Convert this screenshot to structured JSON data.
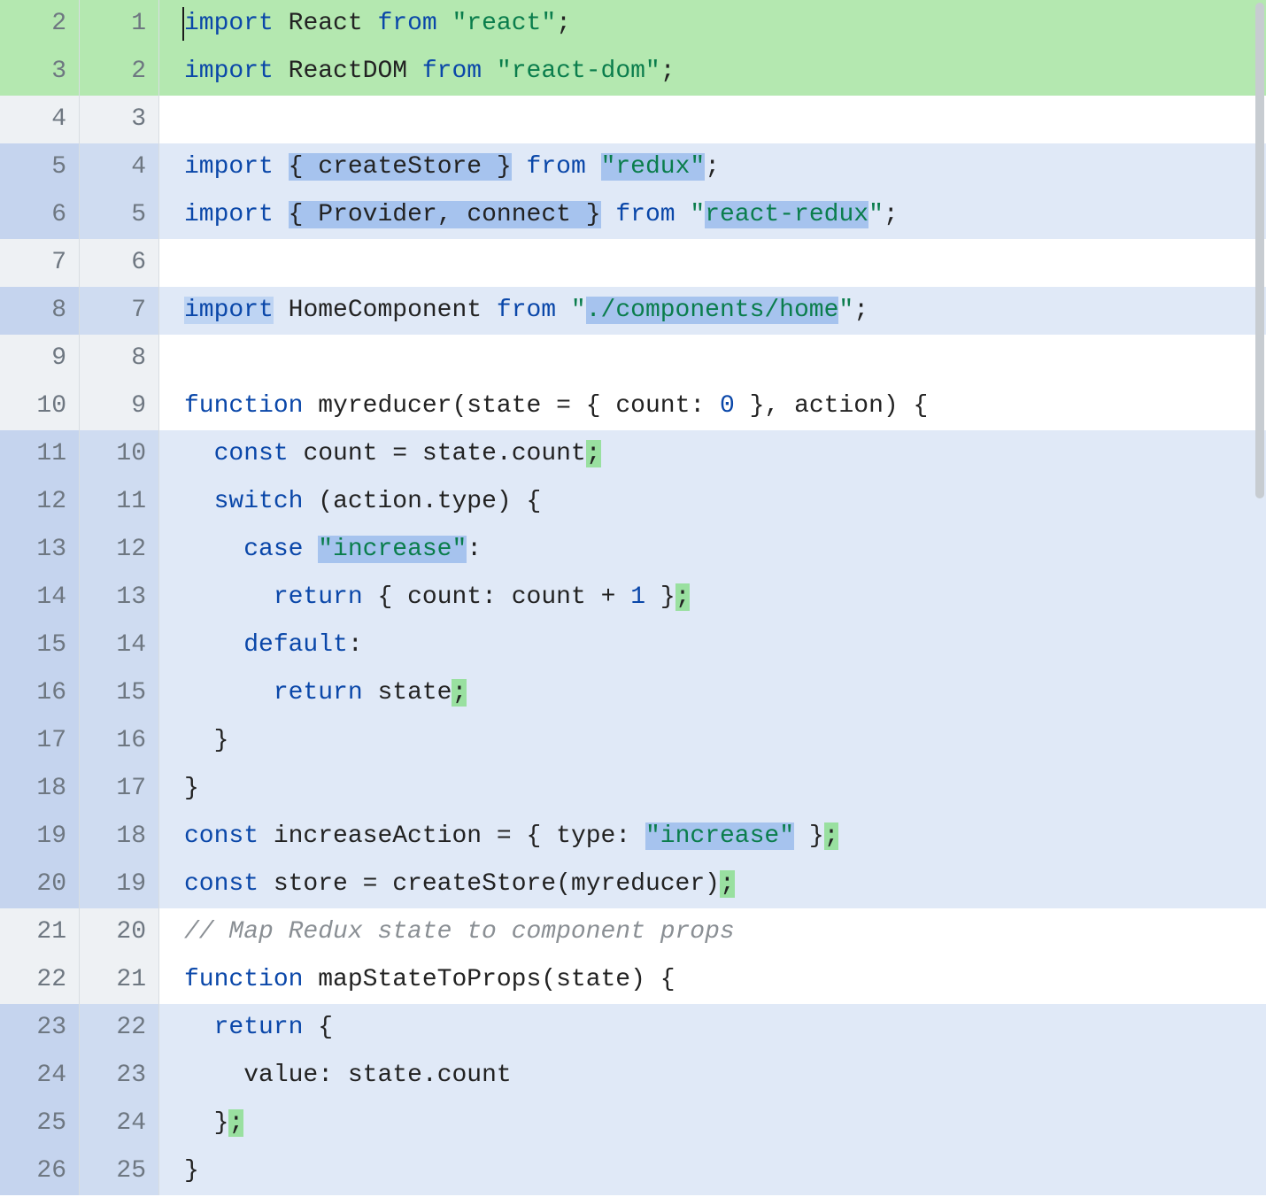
{
  "colors": {
    "add_bg": "#b4e8b0",
    "mod_bg": "#e0e9f7",
    "gutter_bg": "#eef1f4",
    "hl_blue": "#a6c3ee",
    "hl_green": "#99e0a0"
  },
  "rows": [
    {
      "l": "2",
      "r": "1",
      "state": "add",
      "code_html": "<span class='kw'>import</span> <span class='id'>React</span> <span class='kw'>from</span> <span class='str'>\"react\"</span><span class='punc'>;</span>",
      "cursor": true
    },
    {
      "l": "3",
      "r": "2",
      "state": "add",
      "code_html": "<span class='kw'>import</span> <span class='id'>ReactDOM</span> <span class='kw'>from</span> <span class='str'>\"react-dom\"</span><span class='punc'>;</span>"
    },
    {
      "l": "4",
      "r": "3",
      "state": "context",
      "code_html": ""
    },
    {
      "l": "5",
      "r": "4",
      "state": "mod",
      "code_html": "<span class='kw'>import</span> <span class='hl-blue'><span class='punc'>{</span> <span class='id'>createStore</span> <span class='punc'>}</span></span> <span class='kw'>from</span> <span class='str hl-blue'>\"redux\"</span><span class='punc'>;</span>"
    },
    {
      "l": "6",
      "r": "5",
      "state": "mod",
      "code_html": "<span class='kw'>import</span> <span class='hl-blue'><span class='punc'>{</span> <span class='id'>Provider</span><span class='punc'>,</span> <span class='id'>connect</span> <span class='punc'>}</span></span> <span class='kw'>from</span> <span class='str'>\"<span class='hl-blue'>react-redux</span>\"</span><span class='punc'>;</span>"
    },
    {
      "l": "7",
      "r": "6",
      "state": "context",
      "code_html": ""
    },
    {
      "l": "8",
      "r": "7",
      "state": "mod",
      "code_html": "<span class='hl-blue2'><span class='kw'>import</span></span> <span class='id'>HomeComponent</span> <span class='kw'>from</span> <span class='str'>\"<span class='hl-blue'>./components/home</span>\"</span><span class='punc'>;</span>"
    },
    {
      "l": "9",
      "r": "8",
      "state": "context",
      "code_html": ""
    },
    {
      "l": "10",
      "r": "9",
      "state": "context",
      "code_html": "<span class='kw'>function</span> <span class='id'>myreducer</span><span class='punc'>(</span><span class='id'>state</span> <span class='punc'>=</span> <span class='punc'>{</span> <span class='prop'>count</span><span class='punc'>:</span> <span class='num'>0</span> <span class='punc'>}</span><span class='punc'>,</span> <span class='id'>action</span><span class='punc'>)</span> <span class='punc'>{</span>"
    },
    {
      "l": "11",
      "r": "10",
      "state": "mod",
      "code_html": "  <span class='kw'>const</span> <span class='id'>count</span> <span class='punc'>=</span> <span class='id'>state</span><span class='punc'>.</span><span class='prop'>count</span><span class='hl-green'><span class='punc'>;</span></span>"
    },
    {
      "l": "12",
      "r": "11",
      "state": "mod",
      "code_html": "  <span class='kw'>switch</span> <span class='punc'>(</span><span class='id'>action</span><span class='punc'>.</span><span class='prop'>type</span><span class='punc'>)</span> <span class='punc'>{</span>"
    },
    {
      "l": "13",
      "r": "12",
      "state": "mod",
      "code_html": "    <span class='kw'>case</span> <span class='str hl-blue'>\"increase\"</span><span class='punc'>:</span>"
    },
    {
      "l": "14",
      "r": "13",
      "state": "mod",
      "code_html": "      <span class='kw'>return</span> <span class='punc'>{</span> <span class='prop'>count</span><span class='punc'>:</span> <span class='id'>count</span> <span class='punc'>+</span> <span class='num'>1</span> <span class='punc'>}</span><span class='hl-green'><span class='punc'>;</span></span>"
    },
    {
      "l": "15",
      "r": "14",
      "state": "mod",
      "code_html": "    <span class='kw'>default</span><span class='punc'>:</span>"
    },
    {
      "l": "16",
      "r": "15",
      "state": "mod",
      "code_html": "      <span class='kw'>return</span> <span class='id'>state</span><span class='hl-green'><span class='punc'>;</span></span>"
    },
    {
      "l": "17",
      "r": "16",
      "state": "mod",
      "code_html": "  <span class='punc'>}</span>"
    },
    {
      "l": "18",
      "r": "17",
      "state": "mod",
      "code_html": "<span class='punc'>}</span>"
    },
    {
      "l": "19",
      "r": "18",
      "state": "mod",
      "code_html": "<span class='kw'>const</span> <span class='id'>increaseAction</span> <span class='punc'>=</span> <span class='punc'>{</span> <span class='prop'>type</span><span class='punc'>:</span> <span class='hl-blue'><span class='str'>\"increase\"</span></span> <span class='punc'>}</span><span class='hl-green'><span class='punc'>;</span></span>"
    },
    {
      "l": "20",
      "r": "19",
      "state": "mod",
      "code_html": "<span class='kw'>const</span> <span class='id'>store</span> <span class='punc'>=</span> <span class='id'>createStore</span><span class='punc'>(</span><span class='id'>myreducer</span><span class='punc'>)</span><span class='hl-green'><span class='punc'>;</span></span>"
    },
    {
      "l": "21",
      "r": "20",
      "state": "context",
      "code_html": "<span class='cmt'>// Map Redux state to component props</span>"
    },
    {
      "l": "22",
      "r": "21",
      "state": "context",
      "code_html": "<span class='kw'>function</span> <span class='id'>mapStateToProps</span><span class='punc'>(</span><span class='id'>state</span><span class='punc'>)</span> <span class='punc'>{</span>"
    },
    {
      "l": "23",
      "r": "22",
      "state": "mod",
      "code_html": "  <span class='kw'>return</span> <span class='punc'>{</span>"
    },
    {
      "l": "24",
      "r": "23",
      "state": "mod",
      "code_html": "    <span class='prop'>value</span><span class='punc'>:</span> <span class='id'>state</span><span class='punc'>.</span><span class='prop'>count</span>"
    },
    {
      "l": "25",
      "r": "24",
      "state": "mod",
      "code_html": "  <span class='punc'>}</span><span class='hl-green'><span class='punc'>;</span></span>"
    },
    {
      "l": "26",
      "r": "25",
      "state": "mod",
      "code_html": "<span class='punc'>}</span>"
    }
  ]
}
